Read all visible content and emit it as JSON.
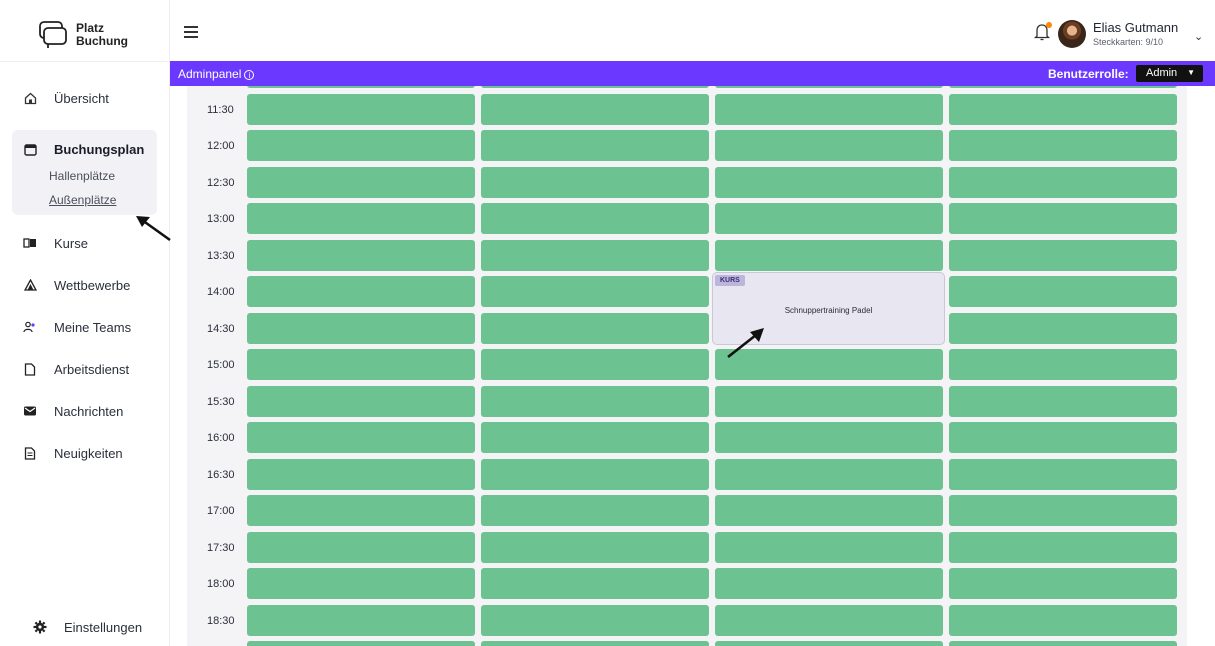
{
  "brand": {
    "line1": "Platz",
    "line2": "Buchung"
  },
  "sidebar": {
    "items": [
      {
        "label": "Übersicht",
        "icon": "home-icon"
      },
      {
        "label": "Buchungsplan",
        "icon": "calendar-icon",
        "sub": [
          "Hallenplätze",
          "Außenplätze"
        ]
      },
      {
        "label": "Kurse",
        "icon": "book-icon"
      },
      {
        "label": "Wettbewerbe",
        "icon": "warning-triangle-icon"
      },
      {
        "label": "Meine Teams",
        "icon": "users-icon"
      },
      {
        "label": "Arbeitsdienst",
        "icon": "document-icon"
      },
      {
        "label": "Nachrichten",
        "icon": "mail-icon"
      },
      {
        "label": "Neuigkeiten",
        "icon": "news-icon"
      }
    ],
    "settings": "Einstellungen"
  },
  "header": {
    "user_name": "Elias Gutmann",
    "user_sub": "Steckkarten: 9/10"
  },
  "adminbar": {
    "label": "Adminpanel",
    "role_label": "Benutzerrolle:",
    "role_value": "Admin"
  },
  "schedule": {
    "times": [
      "11:30",
      "12:00",
      "12:30",
      "13:00",
      "13:30",
      "14:00",
      "14:30",
      "15:00",
      "15:30",
      "16:00",
      "16:30",
      "17:00",
      "17:30",
      "18:00",
      "18:30"
    ],
    "courts": 4,
    "booking": {
      "badge": "KURS",
      "title": "Schnuppertraining Padel",
      "court": 3,
      "start": "14:00",
      "end": "15:00"
    }
  },
  "colors": {
    "accent": "#6a38ff",
    "free_slot": "#6cc290",
    "booking": "#e7e6f1"
  }
}
